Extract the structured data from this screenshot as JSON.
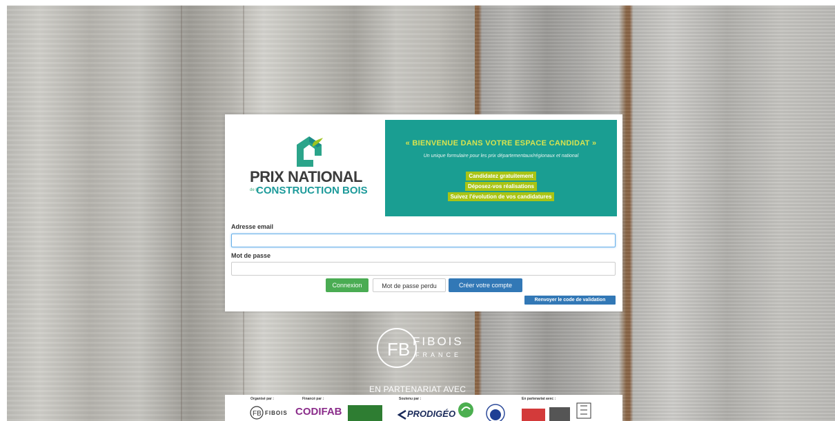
{
  "header": {
    "logo_title": "PRIX NATIONAL",
    "logo_prefix": "de la",
    "logo_subtitle": "CONSTRUCTION BOIS",
    "welcome_title": "« BIENVENUE DANS VOTRE ESPACE CANDIDAT »",
    "welcome_desc": "Un unique formulaire pour les prix départementaux/régionaux et national",
    "features": [
      "Candidatez gratuitement",
      "Déposez-vos réalisations",
      "Suivez l'évolution de vos candidatures"
    ]
  },
  "form": {
    "email_label": "Adresse email",
    "email_value": "",
    "password_label": "Mot de passe",
    "password_value": ""
  },
  "buttons": {
    "login": "Connexion",
    "forgot_password": "Mot de passe perdu",
    "create_account": "Créer votre compte",
    "resend_code": "Renvoyer le code de validation"
  },
  "footer": {
    "fibois_fb": "FB",
    "fibois_name": "FIBOIS",
    "fibois_country": "FRANCE",
    "partner_title": "EN PARTENARIAT AVEC",
    "sponsor_captions": [
      "Organisé par :",
      "Financé par :",
      "Soutenu par :",
      "En partenariat avec :"
    ],
    "sponsors": [
      "FIBOIS",
      "CODIFAB",
      "PRODIGÉO"
    ]
  },
  "colors": {
    "teal": "#1a9e92",
    "lime": "#a9c414",
    "green_button": "#4aac53",
    "blue_button": "#3278b6"
  }
}
